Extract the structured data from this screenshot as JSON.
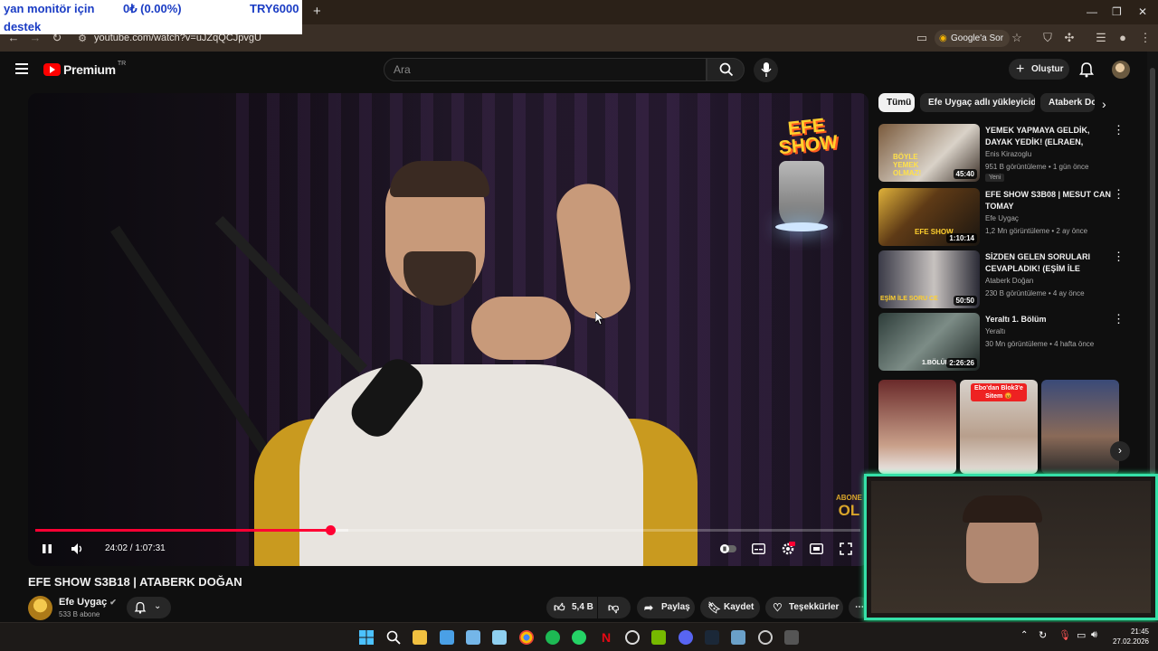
{
  "ticker": {
    "name": "yan monitör için",
    "change": "0₺ (0.00%)",
    "amount": "TRY6000",
    "line2": "destek"
  },
  "browser": {
    "url": "youtube.com/watch?v=uJZqQCJpvgU",
    "google_ask": "Google'a Sor",
    "new_tab": "+"
  },
  "header": {
    "logo_word": "Premium",
    "logo_region": "TR",
    "search_placeholder": "Ara",
    "create_label": "Oluştur"
  },
  "player": {
    "channel_logo_line1": "EFE",
    "channel_logo_line2": "SHOW",
    "abone_top": "ABONE",
    "abone_bottom": "OL",
    "time": "24:02 / 1:07:31",
    "progress": 0.357,
    "buffered": 0.379
  },
  "video": {
    "title": "EFE SHOW S3B18 | ATABERK DOĞAN",
    "channel": "Efe Uygaç",
    "subscribers": "533 B abone",
    "likes": "5,4 B",
    "share": "Paylaş",
    "save": "Kaydet",
    "thanks": "Teşekkürler"
  },
  "chips": [
    "Tümü",
    "Efe Uygaç adlı yükleyiciden",
    "Ataberk Do"
  ],
  "recommendations": [
    {
      "title": "YEMEK YAPMAYA GELDİK, DAYAK YEDİK! (ELRAEN, ERAY,...",
      "channel": "Enis Kirazoglu",
      "meta": "951 B görüntüleme • 1 gün önce",
      "badge": "Yeni",
      "duration": "45:40",
      "thumb_text": "BÖYLE YEMEK OLMAZ!",
      "color": "#7a5a3c"
    },
    {
      "title": "EFE SHOW S3B08 | MESUT CAN TOMAY",
      "channel": "Efe Uygaç",
      "meta": "1,2 Mn görüntüleme • 2 ay önce",
      "badge": "",
      "duration": "1:10:14",
      "thumb_text": "EFE SHOW",
      "color": "#5e3a16"
    },
    {
      "title": "SİZDEN GELEN SORULARI CEVAPLADIK! (EŞİM İLE SORU...",
      "channel": "Ataberk Doğan",
      "meta": "230 B görüntüleme • 4 ay önce",
      "badge": "",
      "duration": "50:50",
      "thumb_text": "EŞİM İLE SORU CE",
      "color": "#3b3b48"
    },
    {
      "title": "Yeraltı 1. Bölüm",
      "channel": "Yeraltı",
      "meta": "30 Mn görüntüleme • 4 hafta önce",
      "badge": "",
      "duration": "2:26:26",
      "thumb_text": "1.BÖLÜM",
      "color": "#2e3d3a"
    }
  ],
  "shorts": [
    {
      "caption": "",
      "color": "#6a2a2a"
    },
    {
      "caption": "Ebo'dan Blok3'e Sitem 😡",
      "color": "#cfc6c0"
    },
    {
      "caption": "",
      "color": "#3a4a78"
    }
  ],
  "clock": {
    "time": "21:45",
    "date": "27.02.2026"
  },
  "colors": {
    "accent": "#ff0033",
    "chip_active": "#f1f1f1",
    "webcam_border": "#35e0a8",
    "ticker_text": "#1a3cc4"
  }
}
